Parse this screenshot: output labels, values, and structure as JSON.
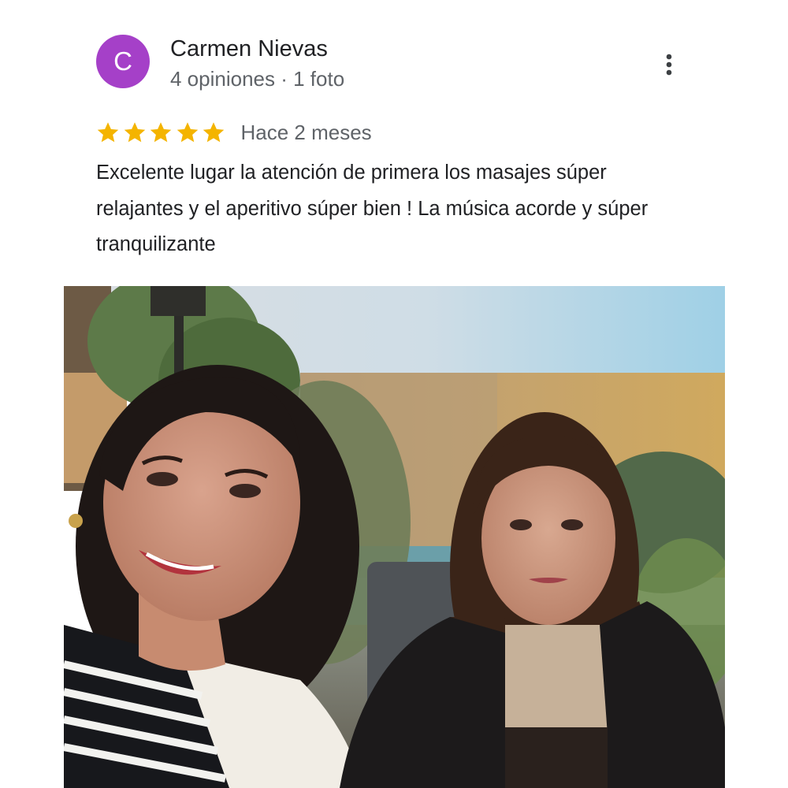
{
  "review": {
    "author": {
      "initial": "C",
      "name": "Carmen Nievas",
      "meta": "4 opiniones · 1 foto",
      "avatar_color": "#a540c8"
    },
    "rating": 5,
    "rating_max": 5,
    "star_color": "#f4b400",
    "time_ago": "Hace 2 meses",
    "text": "Excelente lugar la atención de primera los masajes súper relajantes y el aperitivo súper bien ! La música acorde y súper tranquilizante",
    "more_options_icon": "more-vert-icon",
    "photo_count": 1
  }
}
